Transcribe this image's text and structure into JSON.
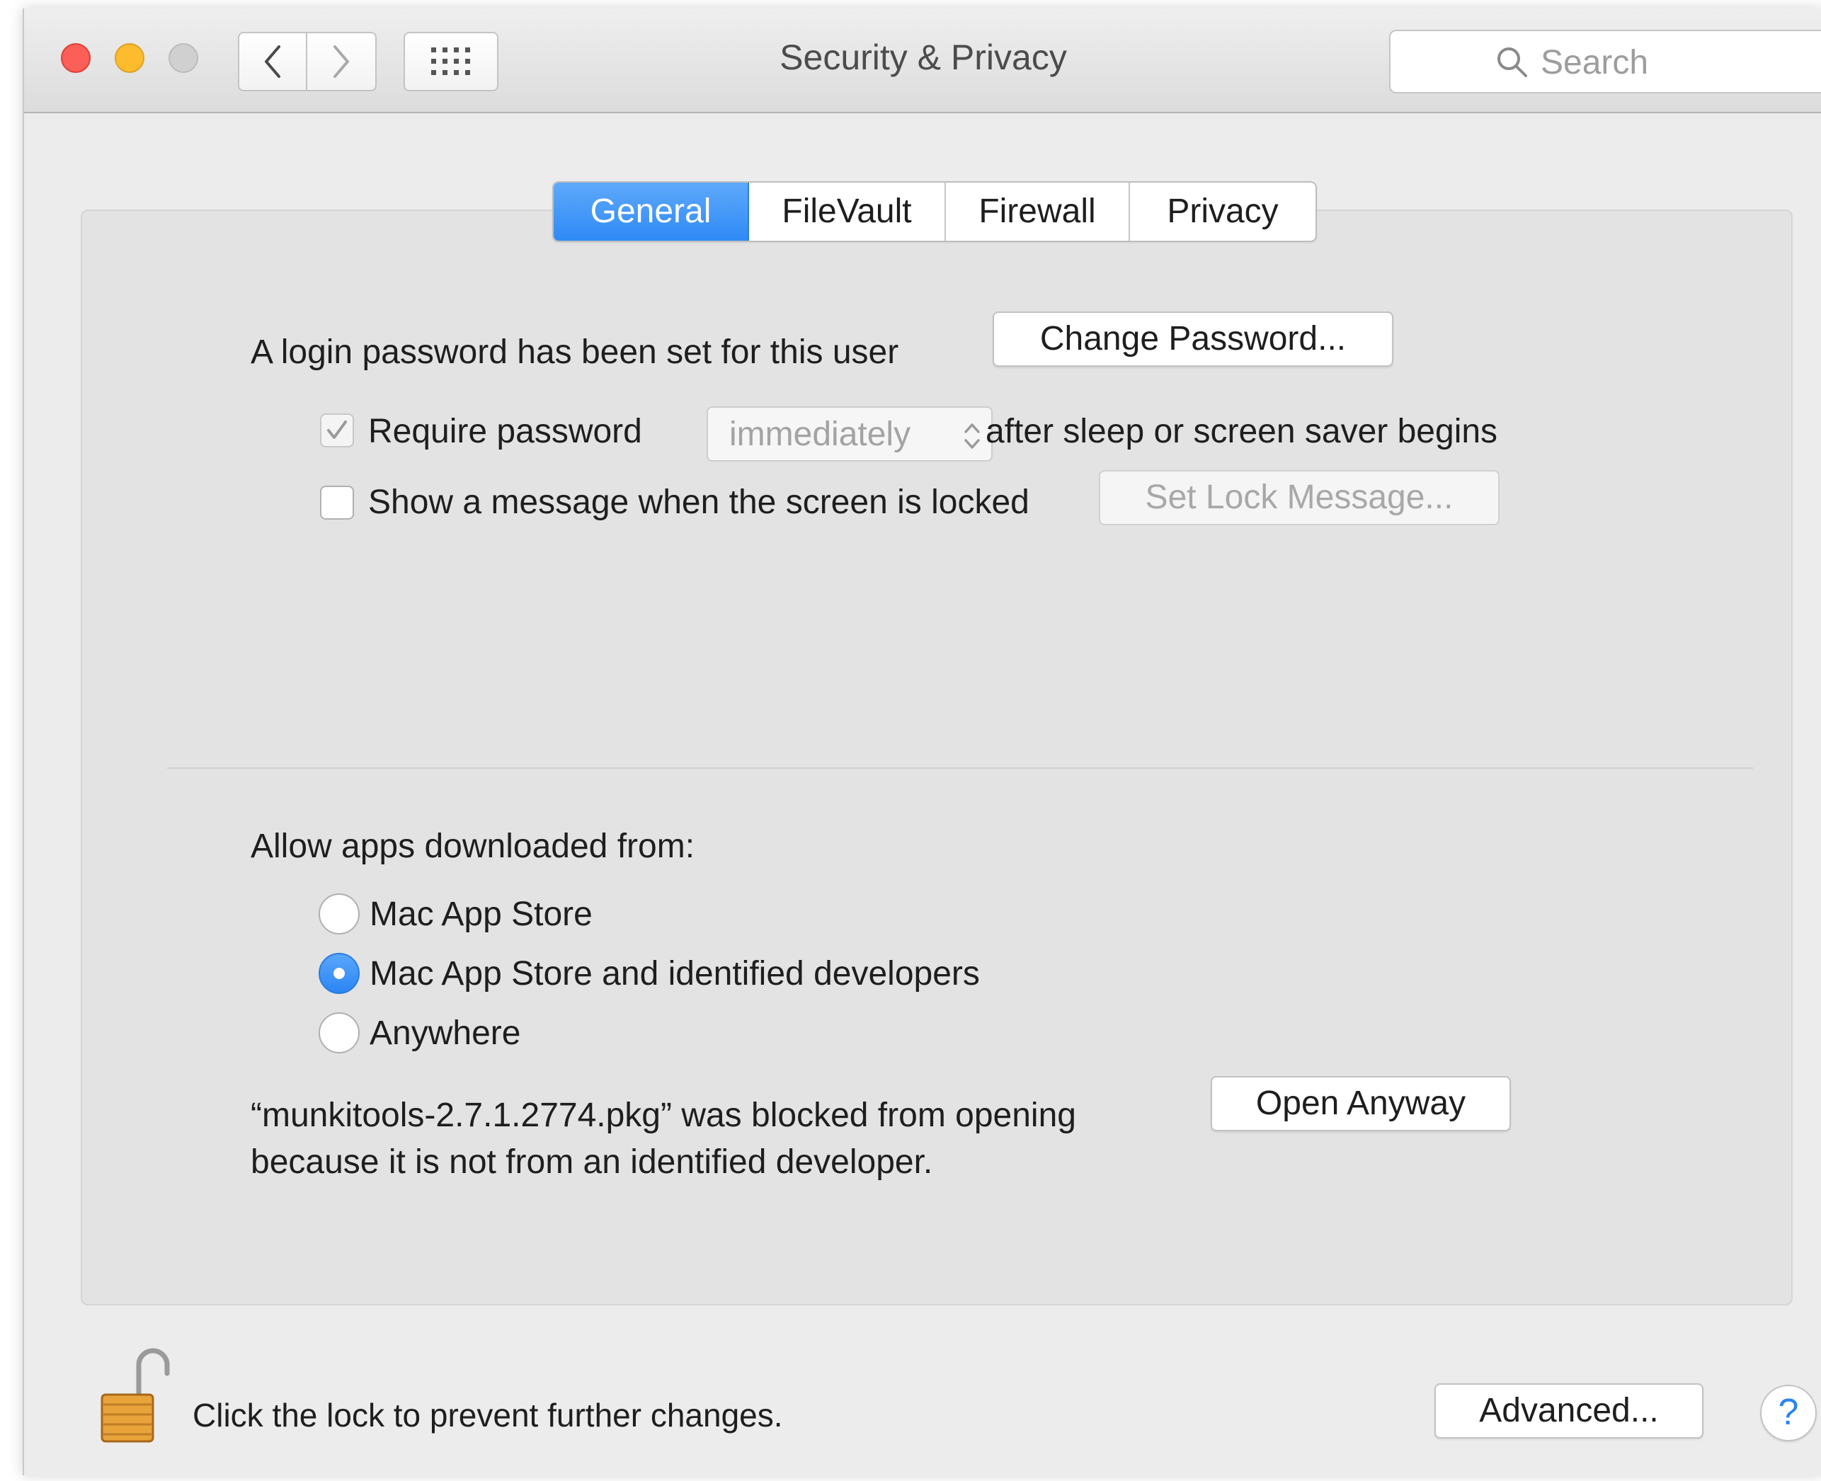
{
  "window": {
    "title": "Security & Privacy",
    "search_placeholder": "Search"
  },
  "tabs": [
    {
      "label": "General",
      "active": true
    },
    {
      "label": "FileVault",
      "active": false
    },
    {
      "label": "Firewall",
      "active": false
    },
    {
      "label": "Privacy",
      "active": false
    }
  ],
  "password": {
    "status_text": "A login password has been set for this user",
    "change_button": "Change Password...",
    "require_label": "Require password",
    "require_checked": true,
    "require_enabled": false,
    "delay_value": "immediately",
    "after_text": "after sleep or screen saver begins",
    "lock_message_label": "Show a message when the screen is locked",
    "lock_message_checked": false,
    "set_lock_message_button": "Set Lock Message..."
  },
  "gatekeeper": {
    "heading": "Allow apps downloaded from:",
    "options": [
      {
        "label": "Mac App Store",
        "selected": false
      },
      {
        "label": "Mac App Store and identified developers",
        "selected": true
      },
      {
        "label": "Anywhere",
        "selected": false
      }
    ],
    "blocked_line1": "“munkitools-2.7.1.2774.pkg” was blocked from opening",
    "blocked_line2": "because it is not from an identified developer.",
    "open_anyway_button": "Open Anyway"
  },
  "footer": {
    "lock_text": "Click the lock to prevent further changes.",
    "lock_state": "unlocked",
    "advanced_button": "Advanced...",
    "help_button": "?"
  },
  "colors": {
    "accent": "#2f8af5",
    "close": "#fc5f57",
    "minimize": "#fdbc2e",
    "zoom_disabled": "#d0d0d0",
    "lock_gold": "#e8a33a"
  },
  "icons": [
    "chevron-left-icon",
    "chevron-right-icon",
    "grid-icon",
    "search-icon",
    "checkmark-icon",
    "updown-arrows-icon",
    "padlock-open-icon"
  ]
}
